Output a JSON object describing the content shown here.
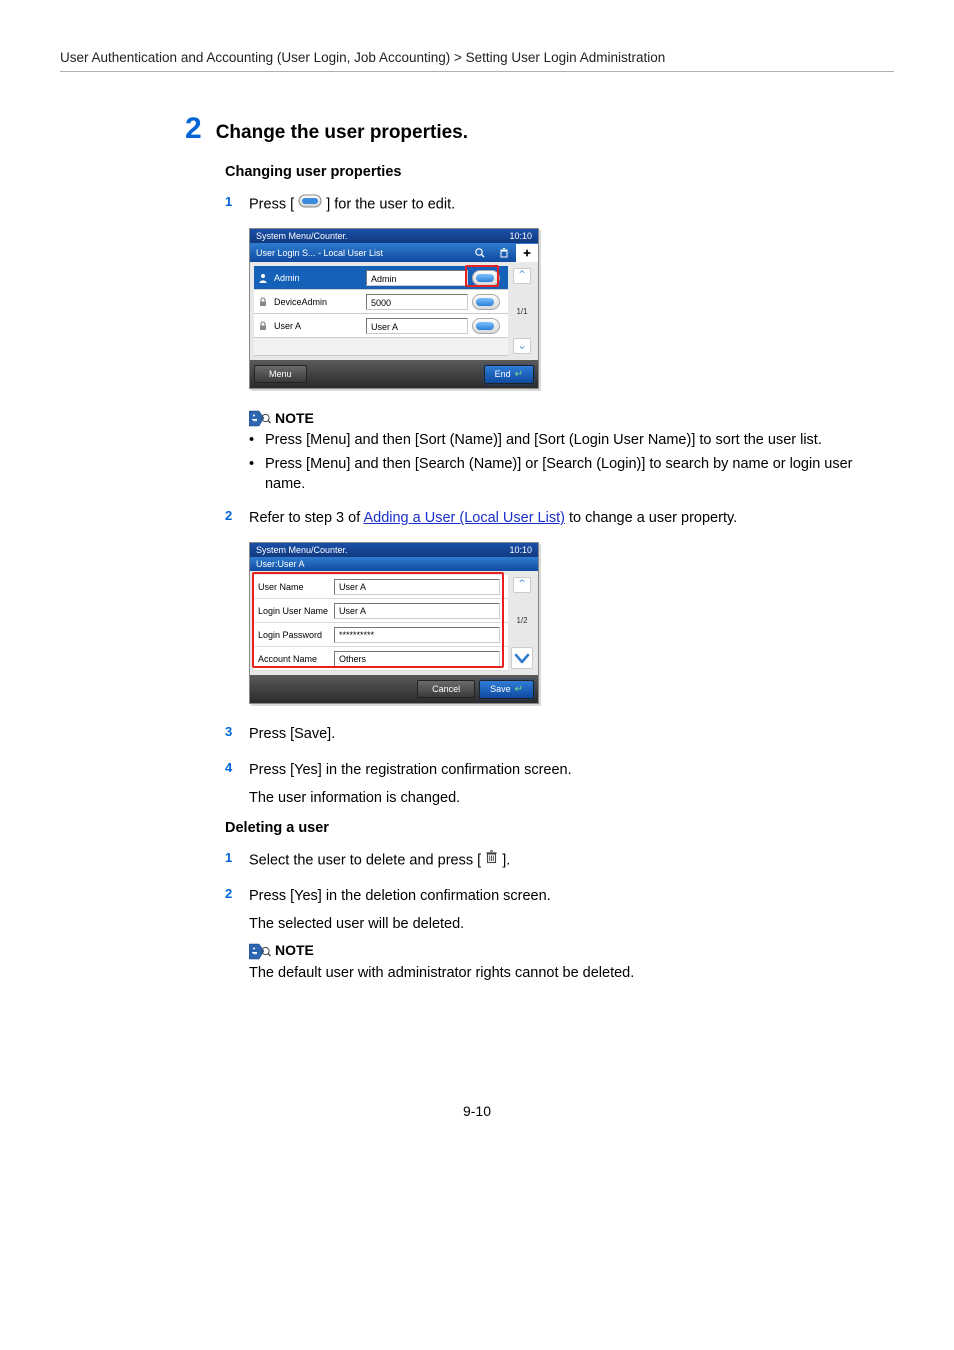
{
  "breadcrumb": "User Authentication and Accounting (User Login, Job Accounting) > Setting User Login Administration",
  "step_number": "2",
  "step_title": "Change the user properties.",
  "sub_heading_change": "Changing user properties",
  "steps": {
    "s1": {
      "n": "1",
      "text_before": "Press [",
      "text_after": "] for the user to edit."
    },
    "s2": {
      "n": "2",
      "text_before": "Refer to step 3 of ",
      "link": "Adding a User (Local User List)",
      "text_after": " to change a user property."
    },
    "s3": {
      "n": "3",
      "text": "Press [Save]."
    },
    "s4": {
      "n": "4",
      "text": "Press [Yes] in the registration confirmation screen."
    },
    "s4_follow": "The user information is changed."
  },
  "sub_heading_delete": "Deleting a user",
  "del_steps": {
    "d1": {
      "n": "1",
      "text_before": "Select the user to delete and press [",
      "text_after": "]."
    },
    "d2": {
      "n": "2",
      "text": "Press [Yes] in the deletion confirmation screen."
    },
    "d2_follow": "The selected user will be deleted."
  },
  "notes": {
    "label": "NOTE",
    "n1_b1": "Press [Menu] and then [Sort (Name)] and [Sort (Login User Name)] to sort the user list.",
    "n1_b2": "Press [Menu] and then [Search (Name)] or [Search (Login)] to search by name or login user name.",
    "n2": "The default user with administrator rights cannot be deleted."
  },
  "panel1": {
    "top_left": "System Menu/Counter.",
    "time": "10:10",
    "header": "User Login S... - Local User List",
    "rows": [
      {
        "name": "Admin",
        "login": "Admin",
        "selected": true
      },
      {
        "name": "DeviceAdmin",
        "login": "5000",
        "selected": false
      },
      {
        "name": "User A",
        "login": "User A",
        "selected": false
      }
    ],
    "page": "1/1",
    "menu": "Menu",
    "end": "End"
  },
  "panel2": {
    "top_left": "System Menu/Counter.",
    "time": "10:10",
    "header": "User:User A",
    "rows": [
      {
        "label": "User Name",
        "value": "User A"
      },
      {
        "label": "Login User Name",
        "value": "User A"
      },
      {
        "label": "Login Password",
        "value": "**********"
      },
      {
        "label": "Account Name",
        "value": "Others"
      }
    ],
    "page": "1/2",
    "cancel": "Cancel",
    "save": "Save"
  },
  "page_number": "9-10"
}
